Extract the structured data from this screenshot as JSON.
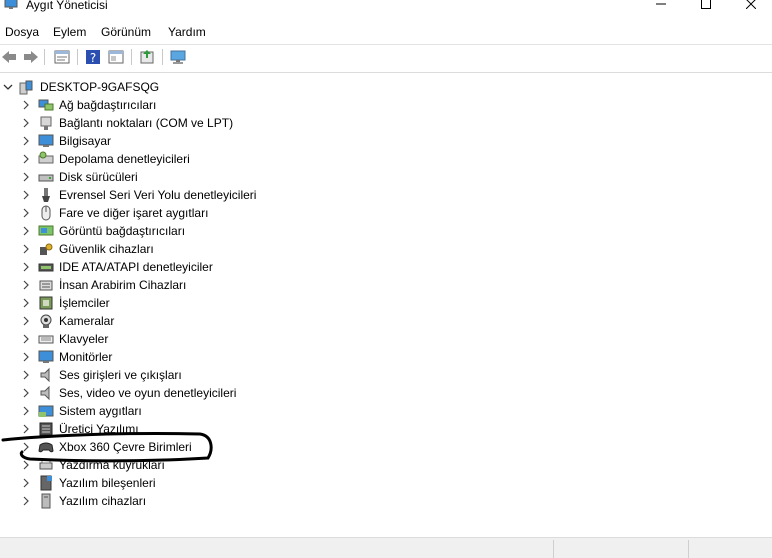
{
  "window": {
    "title": "Aygıt Yöneticisi"
  },
  "menu": [
    "Dosya",
    "Eylem",
    "Görünüm",
    "Yardım"
  ],
  "tree": {
    "root": "DESKTOP-9GAFSQG",
    "items": [
      {
        "label": "Ağ bağdaştırıcıları",
        "icon": "network-adapter-icon"
      },
      {
        "label": "Bağlantı noktaları (COM ve LPT)",
        "icon": "port-icon"
      },
      {
        "label": "Bilgisayar",
        "icon": "computer-icon"
      },
      {
        "label": "Depolama denetleyicileri",
        "icon": "storage-controller-icon"
      },
      {
        "label": "Disk sürücüleri",
        "icon": "disk-drive-icon"
      },
      {
        "label": "Evrensel Seri Veri Yolu denetleyicileri",
        "icon": "usb-icon"
      },
      {
        "label": "Fare ve diğer işaret aygıtları",
        "icon": "mouse-icon"
      },
      {
        "label": "Görüntü bağdaştırıcıları",
        "icon": "display-adapter-icon"
      },
      {
        "label": "Güvenlik cihazları",
        "icon": "security-device-icon"
      },
      {
        "label": "IDE ATA/ATAPI denetleyiciler",
        "icon": "ide-controller-icon"
      },
      {
        "label": "İnsan Arabirim Cihazları",
        "icon": "hid-icon"
      },
      {
        "label": "İşlemciler",
        "icon": "processor-icon"
      },
      {
        "label": "Kameralar",
        "icon": "camera-icon"
      },
      {
        "label": "Klavyeler",
        "icon": "keyboard-icon"
      },
      {
        "label": "Monitörler",
        "icon": "monitor-icon"
      },
      {
        "label": "Ses girişleri ve çıkışları",
        "icon": "audio-io-icon"
      },
      {
        "label": "Ses, video ve oyun denetleyicileri",
        "icon": "sound-video-icon"
      },
      {
        "label": "Sistem aygıtları",
        "icon": "system-devices-icon"
      },
      {
        "label": "Üretici Yazılımı",
        "icon": "firmware-icon"
      },
      {
        "label": "Xbox 360 Çevre Birimleri",
        "icon": "gamepad-icon"
      },
      {
        "label": "Yazdırma kuyrukları",
        "icon": "print-queue-icon"
      },
      {
        "label": "Yazılım bileşenleri",
        "icon": "software-component-icon"
      },
      {
        "label": "Yazılım cihazları",
        "icon": "software-device-icon"
      }
    ]
  },
  "colors": {
    "annotation": "#000000",
    "toolbar_help": "#2a4fb0",
    "monitor_blue": "#1e8fd6"
  }
}
